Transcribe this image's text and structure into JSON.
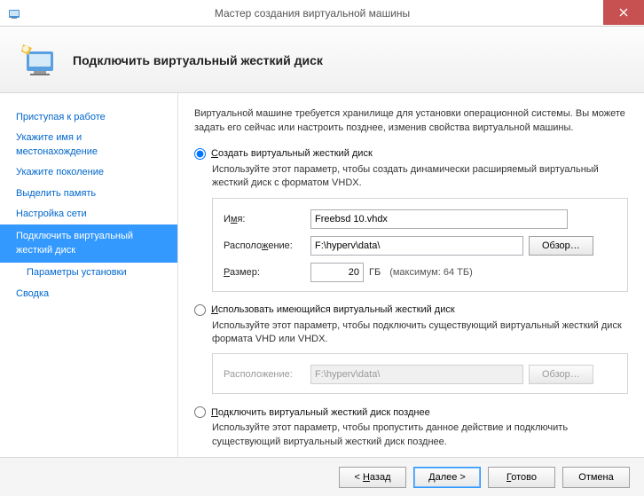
{
  "window": {
    "title": "Мастер создания виртуальной машины"
  },
  "header": {
    "title": "Подключить виртуальный жесткий диск"
  },
  "sidebar": {
    "items": [
      "Приступая к работе",
      "Укажите имя и местонахождение",
      "Укажите поколение",
      "Выделить память",
      "Настройка сети",
      "Подключить виртуальный жесткий диск",
      "Параметры установки",
      "Сводка"
    ]
  },
  "content": {
    "intro": "Виртуальной машине требуется хранилище для установки операционной системы. Вы можете задать его сейчас или настроить позднее, изменив свойства виртуальной машины.",
    "opt1": {
      "label": "Создать виртуальный жесткий диск",
      "desc": "Используйте этот параметр, чтобы создать динамически расширяемый виртуальный жесткий диск с форматом VHDX.",
      "name_label": "Имя:",
      "name_value": "Freebsd 10.vhdx",
      "loc_label": "Расположение:",
      "loc_value": "F:\\hyperv\\data\\",
      "browse": "Обзор…",
      "size_label": "Размер:",
      "size_value": "20",
      "size_unit": "ГБ",
      "size_hint": "(максимум: 64 ТБ)"
    },
    "opt2": {
      "label": "Использовать имеющийся виртуальный жесткий диск",
      "desc": "Используйте этот параметр, чтобы подключить существующий виртуальный жесткий диск формата VHD или VHDX.",
      "loc_label": "Расположение:",
      "loc_value": "F:\\hyperv\\data\\",
      "browse": "Обзор…"
    },
    "opt3": {
      "label": "Подключить виртуальный жесткий диск позднее",
      "desc": "Используйте этот параметр, чтобы пропустить данное действие и подключить существующий виртуальный жесткий диск позднее."
    }
  },
  "footer": {
    "back": "< Назад",
    "next": "Далее >",
    "finish": "Готово",
    "cancel": "Отмена"
  }
}
